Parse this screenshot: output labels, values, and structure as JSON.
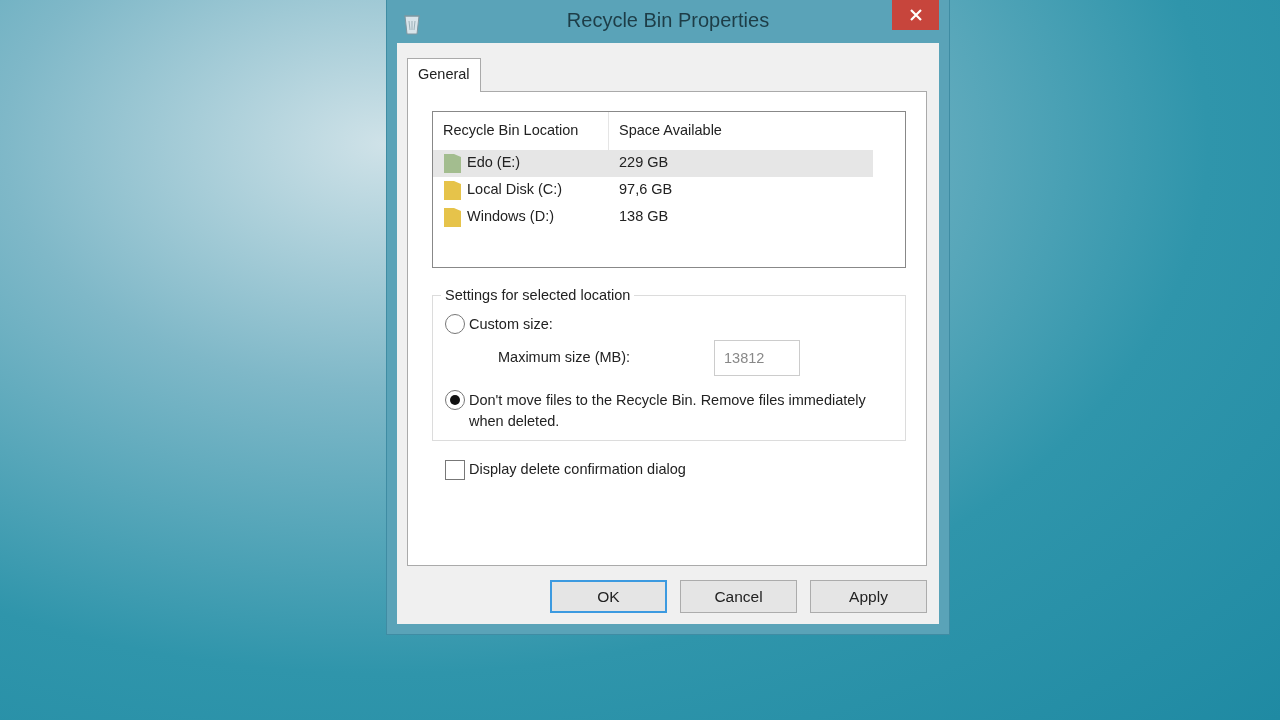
{
  "window": {
    "title": "Recycle Bin Properties"
  },
  "tabs": [
    {
      "label": "General",
      "selected": true
    }
  ],
  "locations": {
    "columns": [
      "Recycle Bin Location",
      "Space Available"
    ],
    "rows": [
      {
        "name": "Edo (E:)",
        "space": "229 GB",
        "selected": true,
        "color": "#a3bd8f"
      },
      {
        "name": "Local Disk (C:)",
        "space": "97,6 GB",
        "selected": false,
        "color": "#e6c34a"
      },
      {
        "name": "Windows (D:)",
        "space": "138 GB",
        "selected": false,
        "color": "#e6c34a"
      }
    ]
  },
  "settings": {
    "title": "Settings for selected location",
    "options": [
      {
        "kind": "size",
        "label": "Custom size:",
        "selected": false,
        "field_label": "Maximum size (MB):",
        "value": "13812",
        "disabled": true
      },
      {
        "kind": "plain",
        "label": "Don't move files to the Recycle Bin. Remove files immediately when deleted.",
        "selected": true
      }
    ]
  },
  "confirm": {
    "label": "Display delete confirmation dialog",
    "checked": false
  },
  "buttons": [
    {
      "label": "OK",
      "default": true
    },
    {
      "label": "Cancel",
      "default": false
    },
    {
      "label": "Apply",
      "default": false
    }
  ]
}
